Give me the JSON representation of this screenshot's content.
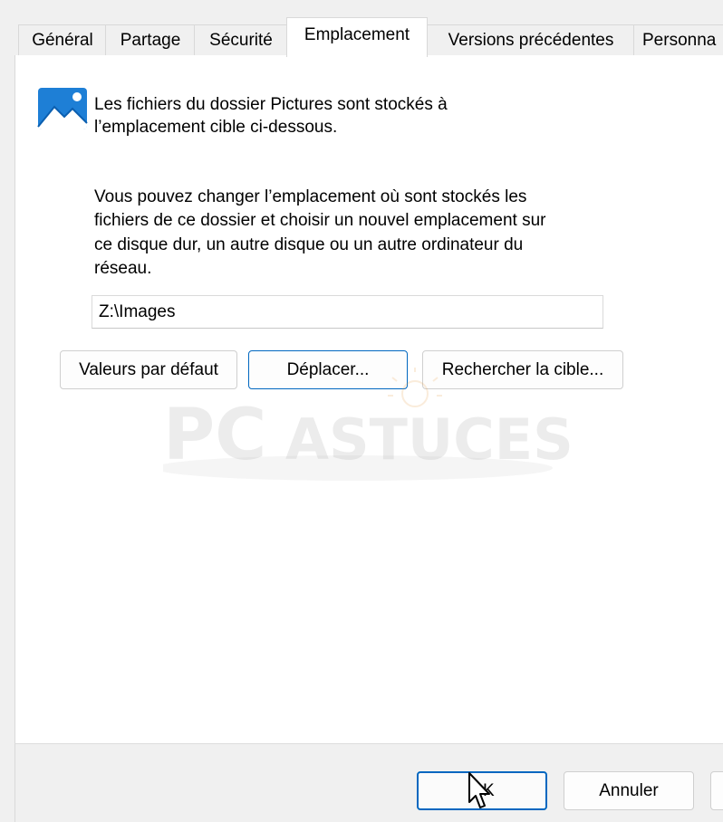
{
  "tabs": [
    {
      "label": "Général"
    },
    {
      "label": "Partage"
    },
    {
      "label": "Sécurité"
    },
    {
      "label": "Emplacement"
    },
    {
      "label": "Versions précédentes"
    },
    {
      "label": "Personna"
    }
  ],
  "active_tab": "Emplacement",
  "header": {
    "line1": "Les fichiers du dossier Pictures sont stockés à",
    "line2": "l’emplacement cible ci-dessous."
  },
  "description": {
    "line1": "Vous pouvez changer l’emplacement où sont stockés les",
    "line2": "fichiers de ce dossier et choisir un nouvel emplacement sur",
    "line3": "ce disque dur, un autre disque ou un autre ordinateur du",
    "line4": "réseau."
  },
  "path_field": {
    "value": "Z:\\Images"
  },
  "buttons": {
    "restore_default": "Valeurs par défaut",
    "move": "Déplacer...",
    "find_target": "Rechercher la cible..."
  },
  "watermark": {
    "part1": "PC",
    "part2": "ASTUCES"
  },
  "footer": {
    "ok": "OK",
    "cancel": "Annuler"
  },
  "colors": {
    "accent": "#0067c0",
    "panel_bg": "#ffffff",
    "window_bg": "#f0f0f0"
  }
}
